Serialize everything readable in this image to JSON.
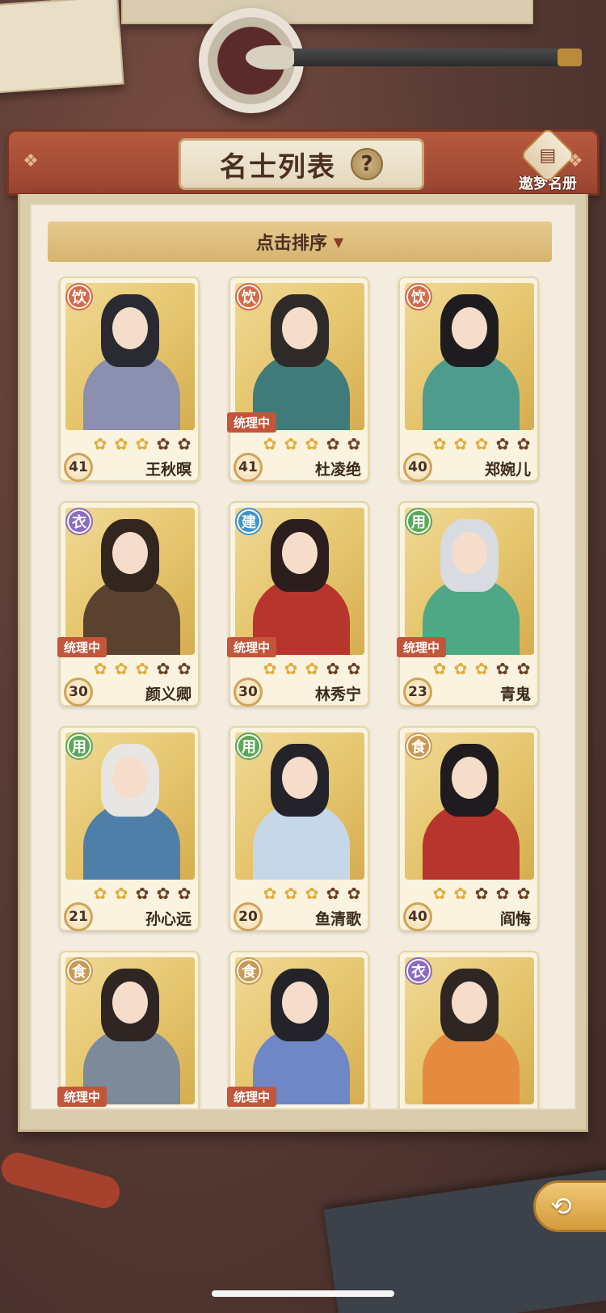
{
  "header": {
    "title": "名士列表",
    "help_label": "?",
    "roster_label": "遨梦名册"
  },
  "sort": {
    "label": "点击排序"
  },
  "colors": {
    "饮": "#d46a4a",
    "衣": "#8a6bc2",
    "建": "#3f94c9",
    "用": "#5aa85a",
    "食": "#c99a55"
  },
  "cards": [
    {
      "name": "王秋暝",
      "level": "41",
      "category": "饮",
      "stars": 3,
      "status": "",
      "hair": "#2a2a33",
      "robe": "#8b8fb0"
    },
    {
      "name": "杜凌绝",
      "level": "41",
      "category": "饮",
      "stars": 3,
      "status": "统理中",
      "hair": "#2f2a28",
      "robe": "#3f7b7a"
    },
    {
      "name": "郑婉儿",
      "level": "40",
      "category": "饮",
      "stars": 3,
      "status": "",
      "hair": "#1e1c1f",
      "robe": "#4f9c8f"
    },
    {
      "name": "颜义卿",
      "level": "30",
      "category": "衣",
      "stars": 3,
      "status": "统理中",
      "hair": "#33261f",
      "robe": "#5a4231"
    },
    {
      "name": "林秀宁",
      "level": "30",
      "category": "建",
      "stars": 3,
      "status": "统理中",
      "hair": "#2b1e1c",
      "robe": "#b7352c"
    },
    {
      "name": "青鬼",
      "level": "23",
      "category": "用",
      "stars": 3,
      "status": "统理中",
      "hair": "#d8dbe0",
      "robe": "#4fa785"
    },
    {
      "name": "孙心远",
      "level": "21",
      "category": "用",
      "stars": 2,
      "status": "",
      "hair": "#e8e6e2",
      "robe": "#4f7fa8"
    },
    {
      "name": "鱼清歌",
      "level": "20",
      "category": "用",
      "stars": 3,
      "status": "",
      "hair": "#24232a",
      "robe": "#c7d7ea"
    },
    {
      "name": "阎悔",
      "level": "40",
      "category": "食",
      "stars": 2,
      "status": "",
      "hair": "#1f1b1e",
      "robe": "#b8352e"
    },
    {
      "name": "",
      "level": "",
      "category": "食",
      "stars": 0,
      "status": "统理中",
      "hair": "#2f2624",
      "robe": "#7c8a9a"
    },
    {
      "name": "",
      "level": "",
      "category": "食",
      "stars": 0,
      "status": "统理中",
      "hair": "#24232a",
      "robe": "#6f87c6"
    },
    {
      "name": "",
      "level": "",
      "category": "衣",
      "stars": 0,
      "status": "",
      "hair": "#2f2624",
      "robe": "#e58b3f"
    }
  ],
  "navigation": {
    "back_icon": "back-arrow-icon"
  }
}
